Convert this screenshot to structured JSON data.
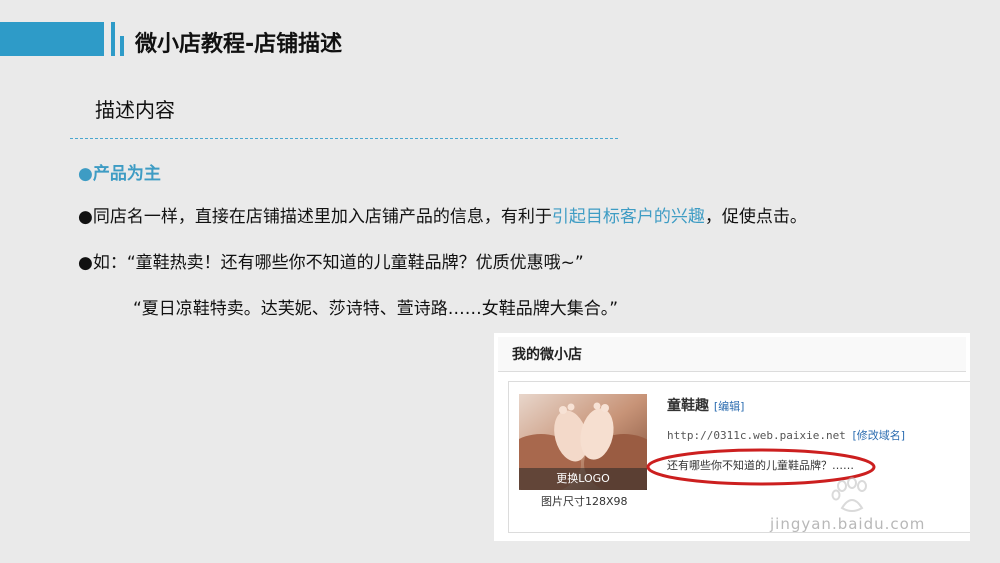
{
  "header": {
    "title": "微小店教程-店铺描述",
    "accent_color": "#2e9bc8"
  },
  "section": {
    "subtitle": "描述内容",
    "bullet_heading": "●产品为主",
    "line1": {
      "before": "●同店名一样，直接在店铺描述里加入店铺产品的信息，有利于",
      "highlight": "引起目标客户的兴趣",
      "after": "，促使点击。"
    },
    "line2": "●如：“童鞋热卖！还有哪些你不知道的儿童鞋品牌？优质优惠哦~”",
    "line3": "“夏日凉鞋特卖。达芙妮、莎诗特、萱诗路……女鞋品牌大集合。”"
  },
  "screenshot": {
    "panel_title": "我的微小店",
    "logo_button": "更换LOGO",
    "logo_caption": "图片尺寸128X98",
    "shop_name": "童鞋趣",
    "edit_link": "[编辑]",
    "shop_url": "http://0311c.web.paixie.net",
    "edit_domain_link": "[修改域名]",
    "shop_description": "还有哪些你不知道的儿童鞋品牌？……",
    "highlight_color": "#cc1f1f"
  },
  "watermark": {
    "text": "jingyan.baidu.com"
  }
}
